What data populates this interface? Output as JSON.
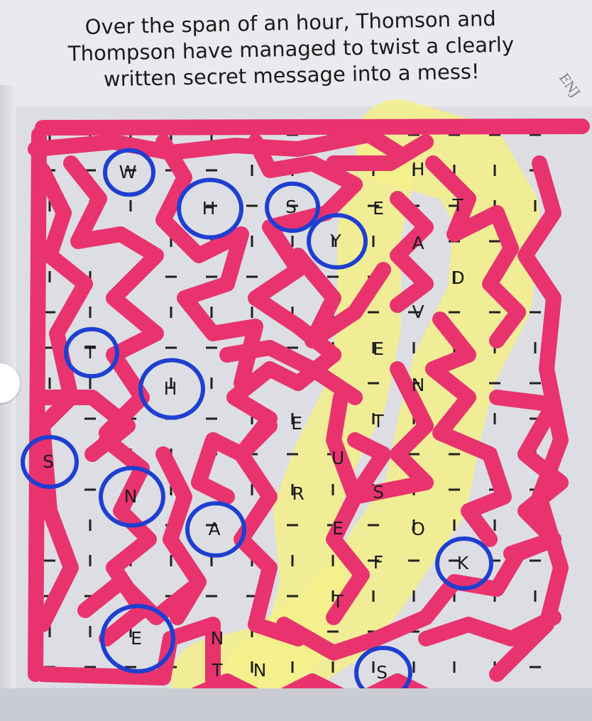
{
  "heading": {
    "line1": "Over the span of an hour, Thomson and",
    "line2": "Thompson have managed to twist a clearly",
    "line3": "written secret message into a mess!"
  },
  "corner_label": "ENJ",
  "colors": {
    "scribble": "#e8336f",
    "circle": "#1e3fd0",
    "highlight": "#f4f08a",
    "grid_line": "#202020"
  },
  "letters": [
    {
      "id": "w",
      "char": "W",
      "circled": true
    },
    {
      "id": "h1",
      "char": "H",
      "circled": true
    },
    {
      "id": "s1",
      "char": "S",
      "circled": true
    },
    {
      "id": "y",
      "char": "Y",
      "circled": true
    },
    {
      "id": "h2",
      "char": "H",
      "circled": false
    },
    {
      "id": "e1",
      "char": "E",
      "circled": false
    },
    {
      "id": "t1",
      "char": "T",
      "circled": false
    },
    {
      "id": "a1",
      "char": "A",
      "circled": false
    },
    {
      "id": "d",
      "char": "D",
      "circled": false
    },
    {
      "id": "v",
      "char": "V",
      "circled": false
    },
    {
      "id": "t2",
      "char": "T",
      "circled": true
    },
    {
      "id": "e2",
      "char": "E",
      "circled": false
    },
    {
      "id": "h3",
      "char": "H",
      "circled": true
    },
    {
      "id": "n1",
      "char": "N",
      "circled": false
    },
    {
      "id": "e3",
      "char": "E",
      "circled": false
    },
    {
      "id": "t3",
      "char": "T",
      "circled": false
    },
    {
      "id": "s2",
      "char": "S",
      "circled": true
    },
    {
      "id": "u",
      "char": "U",
      "circled": false
    },
    {
      "id": "n2",
      "char": "N",
      "circled": true
    },
    {
      "id": "r",
      "char": "R",
      "circled": false
    },
    {
      "id": "s3",
      "char": "S",
      "circled": false
    },
    {
      "id": "a2",
      "char": "A",
      "circled": true
    },
    {
      "id": "e4",
      "char": "E",
      "circled": false
    },
    {
      "id": "o",
      "char": "O",
      "circled": false
    },
    {
      "id": "k",
      "char": "K",
      "circled": true
    },
    {
      "id": "f",
      "char": "F",
      "circled": false
    },
    {
      "id": "t4",
      "char": "T",
      "circled": false
    },
    {
      "id": "e5",
      "char": "E",
      "circled": true
    },
    {
      "id": "n3",
      "char": "N",
      "circled": false
    },
    {
      "id": "t5",
      "char": "T",
      "circled": false
    },
    {
      "id": "n4",
      "char": "N",
      "circled": false
    },
    {
      "id": "s4",
      "char": "S",
      "circled": true
    }
  ]
}
